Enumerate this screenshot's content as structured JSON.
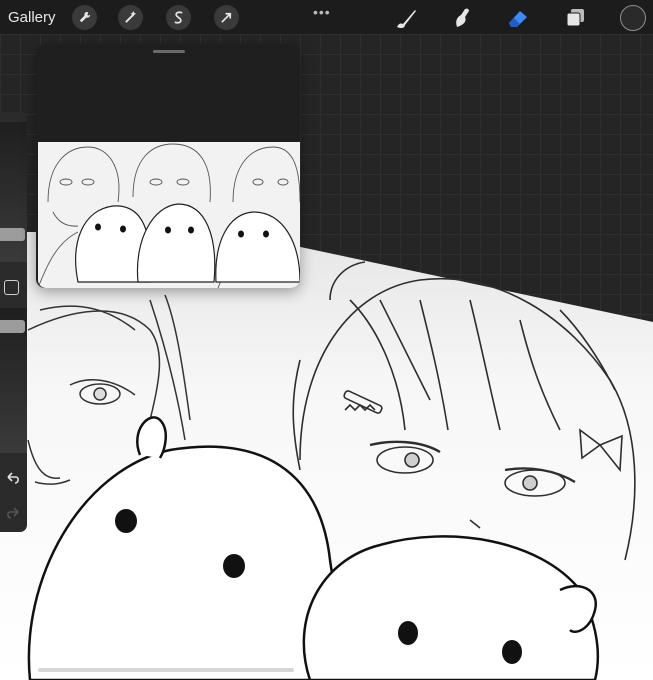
{
  "topbar": {
    "gallery_label": "Gallery",
    "actions_icon": "wrench-icon",
    "adjustments_icon": "magic-wand-icon",
    "selection_icon": "selection-s-icon",
    "transform_icon": "arrow-cursor-icon",
    "more_label": "•••",
    "brush_icon": "brush-icon",
    "smudge_icon": "smudge-icon",
    "eraser_icon": "eraser-icon",
    "layers_icon": "layers-icon",
    "active_tool": "eraser",
    "accent_color": "#3a8bff",
    "current_color": "#2a2a2a"
  },
  "sidebar": {
    "modifier_icon": "square-modifier-icon",
    "undo_icon": "undo-icon",
    "redo_icon": "redo-icon"
  },
  "reference_window": {
    "grabber_icon": "grabber-handle-icon"
  }
}
